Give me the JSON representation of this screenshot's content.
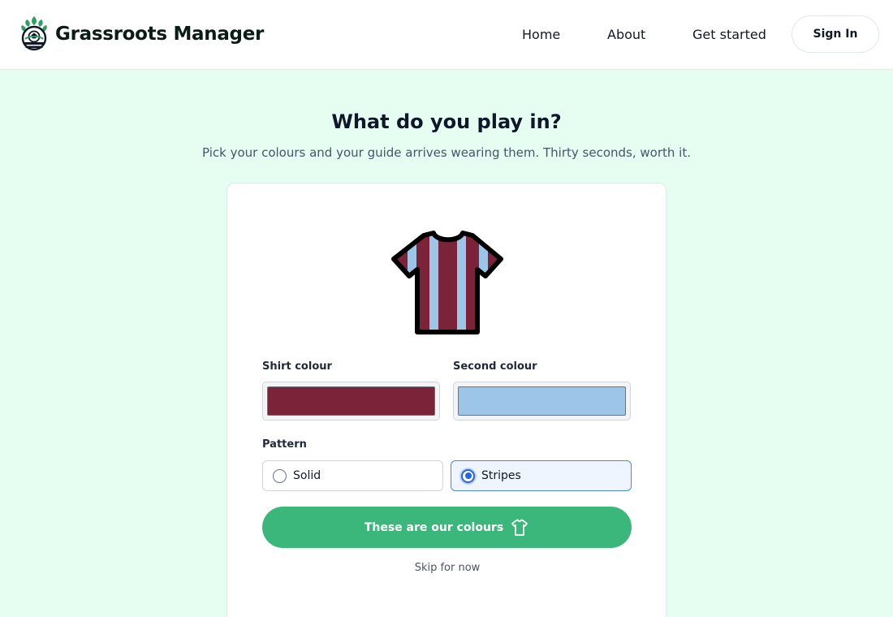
{
  "header": {
    "brand_name": "Grassroots Manager",
    "logo_icon": "football-crest-icon",
    "nav": {
      "home": "Home",
      "about": "About",
      "get_started": "Get started"
    },
    "sign_in_label": "Sign In"
  },
  "main": {
    "title": "What do you play in?",
    "subtitle": "Pick your colours and your guide arrives wearing them. Thirty seconds, worth it."
  },
  "form": {
    "shirt_icon": "striped-shirt-icon",
    "shirt_colour_label": "Shirt colour",
    "shirt_colour_value": "#7b2339",
    "second_colour_label": "Second colour",
    "second_colour_value": "#9cc5e8",
    "pattern_label": "Pattern",
    "patterns": [
      {
        "label": "Solid",
        "selected": false
      },
      {
        "label": "Stripes",
        "selected": true
      }
    ],
    "submit_label": "These are our colours",
    "submit_icon": "shirt-outline-icon",
    "skip_label": "Skip for now"
  },
  "colors": {
    "accent": "#3bb77b",
    "page_background": "#e6fdf2",
    "selected_border": "#4f86d9"
  }
}
